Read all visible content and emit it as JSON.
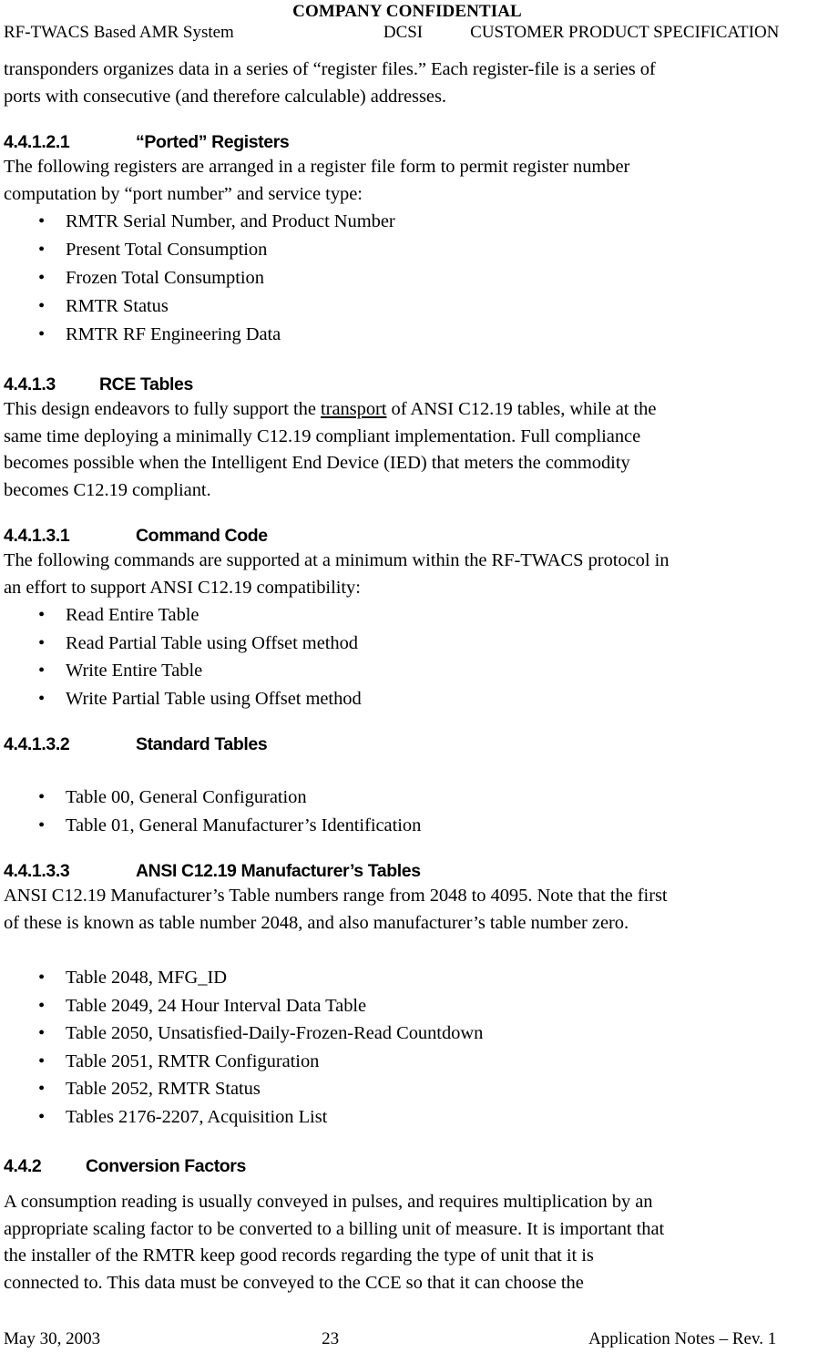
{
  "header": {
    "confidential": "COMPANY CONFIDENTIAL",
    "left": "RF-TWACS Based AMR System",
    "center": "DCSI",
    "right": "CUSTOMER PRODUCT SPECIFICATION"
  },
  "intro_paragraph": {
    "line1": "transponders organizes data in a series of “register files.” Each register-file is a series of",
    "line2": "ports with consecutive (and therefore calculable) addresses."
  },
  "sections": {
    "ported_registers": {
      "number": "4.4.1.2.1",
      "title": "“Ported” Registers",
      "paragraph": {
        "line1": "The following registers are arranged in a register file form to permit register number",
        "line2": "computation by “port number” and service type:"
      },
      "bullets": [
        "RMTR Serial Number, and Product Number",
        "Present Total Consumption",
        "Frozen Total Consumption",
        "RMTR Status",
        "RMTR RF Engineering Data"
      ]
    },
    "rce_tables": {
      "number": "4.4.1.3",
      "title": "RCE Tables",
      "paragraph": {
        "line1_pre": "This design endeavors to fully support the ",
        "line1_underlined": "transport",
        "line1_post": " of ANSI C12.19 tables, while at the",
        "line2": "same time deploying a minimally C12.19 compliant implementation. Full compliance",
        "line3": "becomes possible when the Intelligent End Device (IED) that meters the commodity",
        "line4": "becomes C12.19 compliant."
      }
    },
    "command_code": {
      "number": "4.4.1.3.1",
      "title": "Command Code",
      "paragraph": {
        "line1": "The following commands are supported at a minimum within the RF-TWACS protocol in",
        "line2": "an effort to support ANSI C12.19 compatibility:"
      },
      "bullets": [
        "Read Entire Table",
        "Read Partial Table using Offset method",
        "Write Entire Table",
        "Write Partial Table using Offset method"
      ]
    },
    "standard_tables": {
      "number": "4.4.1.3.2",
      "title": "Standard Tables",
      "bullets": [
        "Table 00, General Configuration",
        "Table 01, General Manufacturer’s Identification"
      ]
    },
    "manufacturer_tables": {
      "number": "4.4.1.3.3",
      "title": "ANSI C12.19 Manufacturer’s Tables",
      "paragraph": {
        "line1": "ANSI C12.19 Manufacturer’s Table numbers range from 2048 to 4095. Note that the first",
        "line2": "of these is known as table number 2048, and also manufacturer’s table number zero."
      },
      "bullets": [
        "Table 2048, MFG_ID",
        "Table 2049, 24 Hour Interval Data Table",
        "Table 2050, Unsatisfied-Daily-Frozen-Read Countdown",
        "Table 2051, RMTR Configuration",
        "Table 2052, RMTR Status",
        "Tables 2176-2207, Acquisition List"
      ]
    },
    "conversion_factors": {
      "number": "4.4.2",
      "title": "Conversion Factors",
      "paragraph": {
        "line1": "A consumption reading is usually conveyed in pulses, and requires multiplication by an",
        "line2": "appropriate scaling factor to be converted to a billing unit of measure. It is important that",
        "line3": "the installer of the RMTR keep good records regarding the type of unit that it is",
        "line4": "connected to. This data must be conveyed to the CCE so that it can choose the"
      }
    }
  },
  "footer": {
    "date": "May 30, 2003",
    "page_number": "23",
    "doc_ref": "Application Notes – Rev. 1"
  },
  "bullet_glyph": "•"
}
